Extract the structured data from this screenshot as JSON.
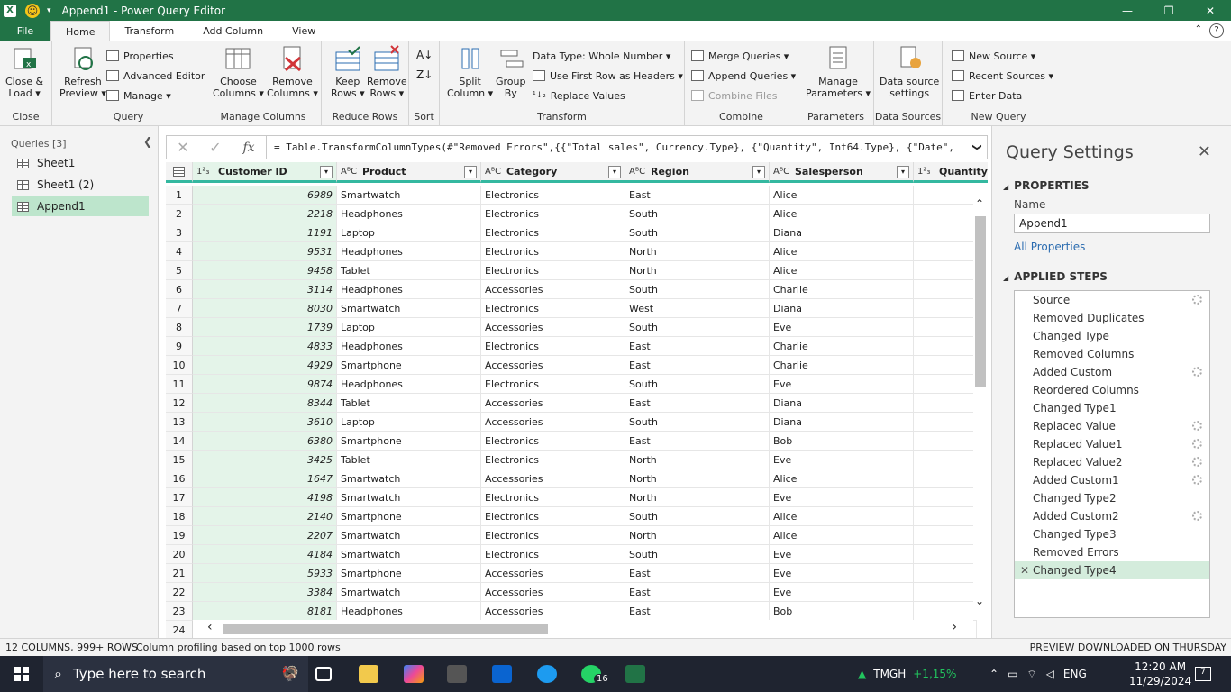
{
  "window": {
    "title": "Append1 - Power Query Editor",
    "restore": "❐",
    "close": "✕",
    "minimize": "—"
  },
  "tabs": [
    "File",
    "Home",
    "Transform",
    "Add Column",
    "View"
  ],
  "ribbon": {
    "close_group": {
      "label": "Close",
      "btn1": "Close &",
      "btn2": "Load ▾"
    },
    "query_group": {
      "label": "Query",
      "refresh1": "Refresh",
      "refresh2": "Preview ▾",
      "properties": "Properties",
      "advanced": "Advanced Editor",
      "manage": "Manage ▾"
    },
    "manage_columns": {
      "label": "Manage Columns",
      "choose1": "Choose",
      "choose2": "Columns ▾",
      "remove1": "Remove",
      "remove2": "Columns ▾"
    },
    "reduce_rows": {
      "label": "Reduce Rows",
      "keep1": "Keep",
      "keep2": "Rows ▾",
      "remove1": "Remove",
      "remove2": "Rows ▾"
    },
    "sort": {
      "label": "Sort"
    },
    "transform": {
      "label": "Transform",
      "split1": "Split",
      "split2": "Column ▾",
      "group1": "Group",
      "group2": "By",
      "datatype": "Data Type: Whole Number ▾",
      "firstrow": "Use First Row as Headers ▾",
      "replace": "Replace Values"
    },
    "combine": {
      "label": "Combine",
      "merge": "Merge Queries ▾",
      "append": "Append Queries ▾",
      "files": "Combine Files"
    },
    "parameters": {
      "label": "Parameters",
      "manage1": "Manage",
      "manage2": "Parameters ▾"
    },
    "datasources": {
      "label": "Data Sources",
      "ds1": "Data source",
      "ds2": "settings"
    },
    "newquery": {
      "label": "New Query",
      "newsource": "New Source ▾",
      "recent": "Recent Sources ▾",
      "enter": "Enter Data"
    }
  },
  "formula": {
    "cancel": "✕",
    "commit": "✓",
    "fx": "fx",
    "text": "= Table.TransformColumnTypes(#\"Removed Errors\",{{\"Total sales\", Currency.Type}, {\"Quantity\", Int64.Type}, {\"Date\",",
    "expand": "❯"
  },
  "queries": {
    "header": "Queries [3]",
    "collapse": "❮",
    "items": [
      "Sheet1",
      "Sheet1 (2)",
      "Append1"
    ]
  },
  "columns": [
    {
      "type": "1²₃",
      "name": "Customer ID"
    },
    {
      "type": "AᴮC",
      "name": "Product"
    },
    {
      "type": "AᴮC",
      "name": "Category"
    },
    {
      "type": "AᴮC",
      "name": "Region"
    },
    {
      "type": "AᴮC",
      "name": "Salesperson"
    },
    {
      "type": "1²₃",
      "name": "Quantity"
    }
  ],
  "rows": [
    [
      "1",
      "6989",
      "Smartwatch",
      "Electronics",
      "East",
      "Alice"
    ],
    [
      "2",
      "2218",
      "Headphones",
      "Electronics",
      "South",
      "Alice"
    ],
    [
      "3",
      "1191",
      "Laptop",
      "Electronics",
      "South",
      "Diana"
    ],
    [
      "4",
      "9531",
      "Headphones",
      "Electronics",
      "North",
      "Alice"
    ],
    [
      "5",
      "9458",
      "Tablet",
      "Electronics",
      "North",
      "Alice"
    ],
    [
      "6",
      "3114",
      "Headphones",
      "Accessories",
      "South",
      "Charlie"
    ],
    [
      "7",
      "8030",
      "Smartwatch",
      "Electronics",
      "West",
      "Diana"
    ],
    [
      "8",
      "1739",
      "Laptop",
      "Accessories",
      "South",
      "Eve"
    ],
    [
      "9",
      "4833",
      "Headphones",
      "Electronics",
      "East",
      "Charlie"
    ],
    [
      "10",
      "4929",
      "Smartphone",
      "Accessories",
      "East",
      "Charlie"
    ],
    [
      "11",
      "9874",
      "Headphones",
      "Electronics",
      "South",
      "Eve"
    ],
    [
      "12",
      "8344",
      "Tablet",
      "Accessories",
      "East",
      "Diana"
    ],
    [
      "13",
      "3610",
      "Laptop",
      "Accessories",
      "South",
      "Diana"
    ],
    [
      "14",
      "6380",
      "Smartphone",
      "Electronics",
      "East",
      "Bob"
    ],
    [
      "15",
      "3425",
      "Tablet",
      "Electronics",
      "North",
      "Eve"
    ],
    [
      "16",
      "1647",
      "Smartwatch",
      "Accessories",
      "North",
      "Alice"
    ],
    [
      "17",
      "4198",
      "Smartwatch",
      "Electronics",
      "North",
      "Eve"
    ],
    [
      "18",
      "2140",
      "Smartphone",
      "Electronics",
      "South",
      "Alice"
    ],
    [
      "19",
      "2207",
      "Smartwatch",
      "Electronics",
      "North",
      "Alice"
    ],
    [
      "20",
      "4184",
      "Smartwatch",
      "Electronics",
      "South",
      "Eve"
    ],
    [
      "21",
      "5933",
      "Smartphone",
      "Accessories",
      "East",
      "Eve"
    ],
    [
      "22",
      "3384",
      "Smartwatch",
      "Accessories",
      "East",
      "Eve"
    ],
    [
      "23",
      "8181",
      "Headphones",
      "Accessories",
      "East",
      "Bob"
    ],
    [
      "24",
      "",
      "",
      "",
      "",
      ""
    ]
  ],
  "settings": {
    "title": "Query Settings",
    "close": "✕",
    "properties": "PROPERTIES",
    "name_label": "Name",
    "name_value": "Append1",
    "all_properties": "All Properties",
    "applied_steps": "APPLIED STEPS",
    "steps": [
      {
        "name": "Source",
        "gear": true
      },
      {
        "name": "Removed Duplicates",
        "gear": false
      },
      {
        "name": "Changed Type",
        "gear": false
      },
      {
        "name": "Removed Columns",
        "gear": false
      },
      {
        "name": "Added Custom",
        "gear": true
      },
      {
        "name": "Reordered Columns",
        "gear": false
      },
      {
        "name": "Changed Type1",
        "gear": false
      },
      {
        "name": "Replaced Value",
        "gear": true
      },
      {
        "name": "Replaced Value1",
        "gear": true
      },
      {
        "name": "Replaced Value2",
        "gear": true
      },
      {
        "name": "Added Custom1",
        "gear": true
      },
      {
        "name": "Changed Type2",
        "gear": false
      },
      {
        "name": "Added Custom2",
        "gear": true
      },
      {
        "name": "Changed Type3",
        "gear": false
      },
      {
        "name": "Removed Errors",
        "gear": false
      },
      {
        "name": "Changed Type4",
        "gear": false,
        "selected": true
      }
    ]
  },
  "status": {
    "columns": "12 COLUMNS, 999+ ROWS",
    "profiling": "Column profiling based on top 1000 rows",
    "preview": "PREVIEW DOWNLOADED ON THURSDAY"
  },
  "taskbar": {
    "search": "Type here to search",
    "stock": "TMGH",
    "stock_change": "+1,15%",
    "lang": "ENG",
    "time": "12:20 AM",
    "date": "11/29/2024",
    "notif": "7",
    "whatsapp_badge": "16"
  },
  "colors": {
    "accent": "#217346",
    "selected_query": "#bde5cc",
    "column_highlight": "#e4f4e9",
    "header_underline": "#34b8a0"
  }
}
